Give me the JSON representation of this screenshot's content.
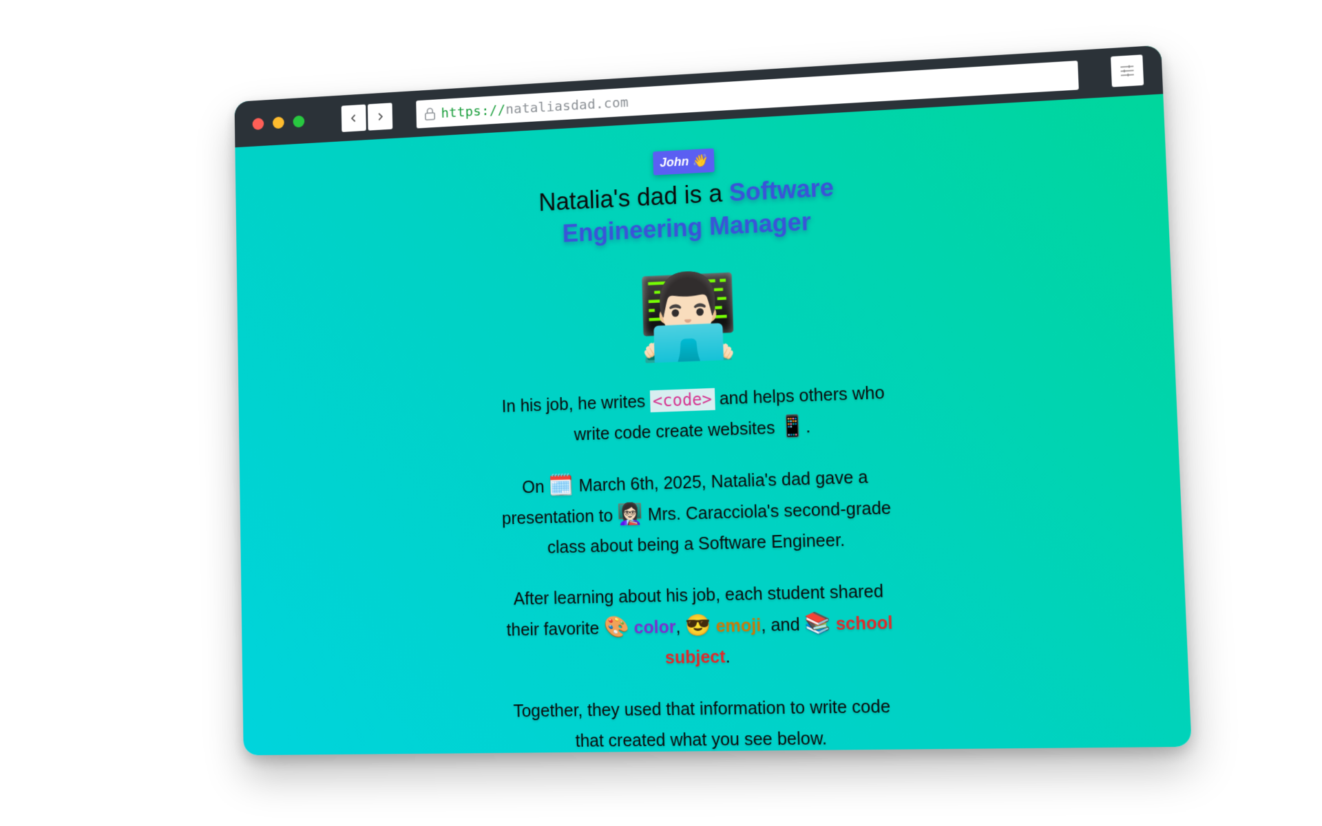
{
  "browser": {
    "url_scheme": "https://",
    "url_host": "nataliasdad.com"
  },
  "page": {
    "badge": {
      "name": "John",
      "emoji": "👋"
    },
    "headline": {
      "prefix": "Natalia's dad is a",
      "role": "Software Engineering Manager"
    },
    "hero_emoji": "👨🏻‍💻",
    "paragraph1": {
      "part1": "In his job, he writes",
      "code": "<code>",
      "part2": "and helps others who write code create websites",
      "emoji": "📱",
      "end": "."
    },
    "paragraph2": {
      "on": "On",
      "calendar_emoji": "🗓️",
      "part1": "March 6th, 2025, Natalia's dad gave a presentation to",
      "teacher_emoji": "👩🏻‍🏫",
      "part2": "Mrs. Caracciola's second-grade class about being a Software Engineer."
    },
    "paragraph3": {
      "part1": "After learning about his job, each student shared their favorite",
      "color_emoji": "🎨",
      "color": "color",
      "sep1": ",",
      "emoji_emoji": "😎",
      "emoji": "emoji",
      "sep2": ", and",
      "subject_emoji": "📚",
      "subject": "school subject",
      "end": "."
    },
    "paragraph4": "Together, they used that information to write code that created what you see below."
  },
  "colors": {
    "gradient_start": "#00d4dc",
    "gradient_end": "#00d69a",
    "chrome": "#2b3238",
    "badge": "#5b5ff2",
    "role": "#3a54d8",
    "code": "#d6338f",
    "color_word": "#7a2fd0",
    "emoji_word": "#c87a0a",
    "subject_word": "#e02a2a"
  }
}
